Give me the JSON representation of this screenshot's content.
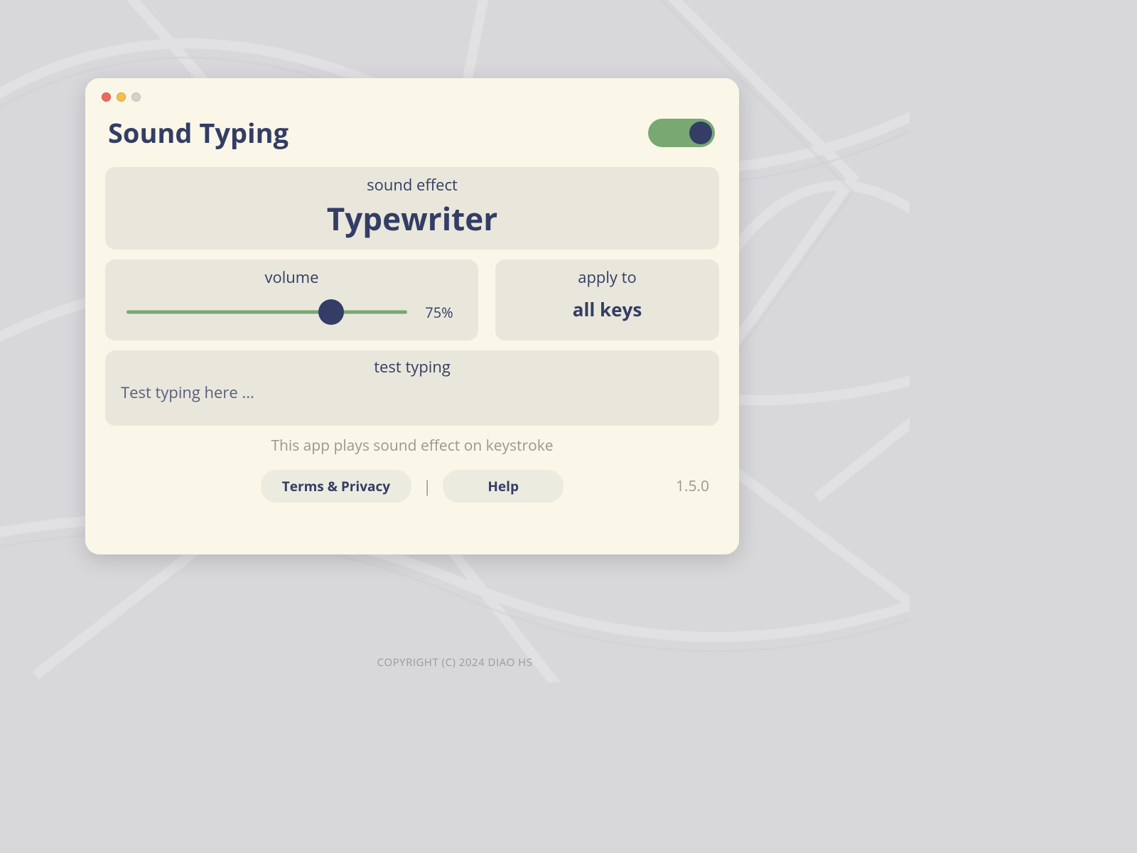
{
  "app": {
    "title": "Sound Typing",
    "enabled": true
  },
  "sound_effect": {
    "label": "sound effect",
    "value": "Typewriter"
  },
  "volume": {
    "label": "volume",
    "percent": 75,
    "display": "75%"
  },
  "apply_to": {
    "label": "apply to",
    "value": "all keys"
  },
  "test": {
    "label": "test typing",
    "placeholder": "Test typing here ..."
  },
  "subtitle": "This app plays sound effect on keystroke",
  "footer": {
    "terms": "Terms & Privacy",
    "help": "Help",
    "separator": "|"
  },
  "version": "1.5.0",
  "copyright": "COPYRIGHT (C) 2024 DIAO HS",
  "colors": {
    "accent": "#333d65",
    "toggle_on": "#79a872",
    "panel_bg": "#e9e7db",
    "window_bg": "#faf7e8"
  }
}
